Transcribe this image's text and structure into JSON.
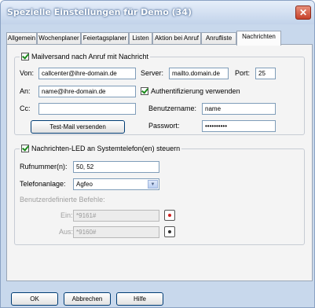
{
  "window": {
    "title": "Spezielle Einstellungen für Demo (34)",
    "close_glyph": "✕"
  },
  "tabs": [
    {
      "label": "Allgemein"
    },
    {
      "label": "Wochenplaner"
    },
    {
      "label": "Feiertagsplaner"
    },
    {
      "label": "Listen"
    },
    {
      "label": "Aktion bei Anruf"
    },
    {
      "label": "Anrufliste"
    },
    {
      "label": "Nachrichten",
      "active": true
    }
  ],
  "mail": {
    "checkbox_label": "Mailversand nach Anruf mit Nachricht",
    "von_label": "Von:",
    "von_value": "callcenter@ihre-domain.de",
    "server_label": "Server:",
    "server_value": "mailto.domain.de",
    "port_label": "Port:",
    "port_value": "25",
    "an_label": "An:",
    "an_value": "name@ihre-domain.de",
    "auth_label": "Authentifizierung verwenden",
    "cc_label": "Cc:",
    "cc_value": "",
    "username_label": "Benutzername:",
    "username_value": "name",
    "test_button": "Test-Mail versenden",
    "password_label": "Passwort:",
    "password_value": "••••••••••"
  },
  "led": {
    "checkbox_label": "Nachrichten-LED an Systemtelefon(en) steuern",
    "rufnummer_label": "Rufnummer(n):",
    "rufnummer_value": "50, 52",
    "anlage_label": "Telefonanlage:",
    "anlage_value": "Agfeo",
    "custom_label": "Benutzerdefinierte Befehle:",
    "ein_label": "Ein:",
    "ein_value": "*9161#",
    "aus_label": "Aus:",
    "aus_value": "*9160#"
  },
  "buttons": {
    "ok": "OK",
    "cancel": "Abbrechen",
    "help": "Hilfe"
  },
  "colors": {
    "led_on": "#d02020",
    "led_off": "#303030"
  }
}
